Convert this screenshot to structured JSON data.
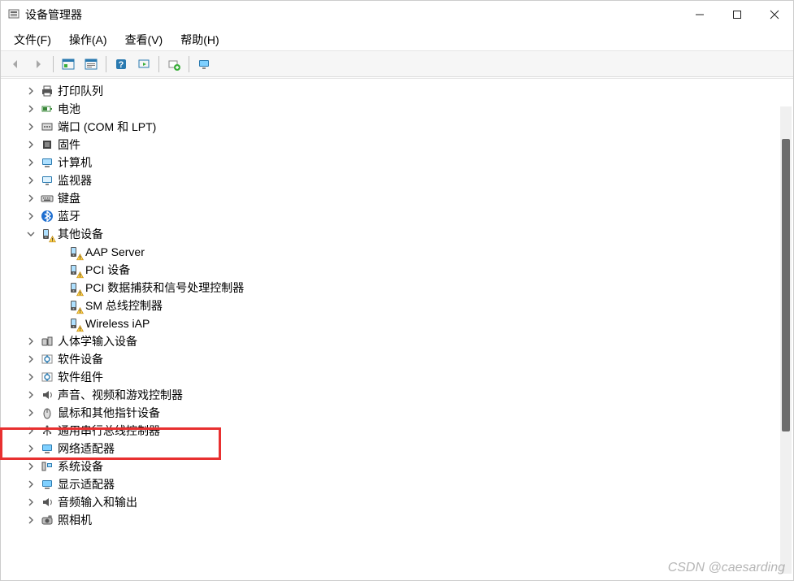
{
  "window": {
    "title": "设备管理器"
  },
  "menu": {
    "file": "文件(F)",
    "action": "操作(A)",
    "view": "查看(V)",
    "help": "帮助(H)"
  },
  "tree": {
    "items": [
      {
        "label": "打印队列",
        "icon": "printer",
        "expand": "collapsed",
        "level": 0
      },
      {
        "label": "电池",
        "icon": "battery",
        "expand": "collapsed",
        "level": 0
      },
      {
        "label": "端口 (COM 和 LPT)",
        "icon": "port",
        "expand": "collapsed",
        "level": 0
      },
      {
        "label": "固件",
        "icon": "firmware",
        "expand": "collapsed",
        "level": 0
      },
      {
        "label": "计算机",
        "icon": "computer",
        "expand": "collapsed",
        "level": 0
      },
      {
        "label": "监视器",
        "icon": "monitor",
        "expand": "collapsed",
        "level": 0
      },
      {
        "label": "键盘",
        "icon": "keyboard",
        "expand": "collapsed",
        "level": 0
      },
      {
        "label": "蓝牙",
        "icon": "bluetooth",
        "expand": "collapsed",
        "level": 0
      },
      {
        "label": "其他设备",
        "icon": "other",
        "expand": "expanded",
        "level": 0,
        "warn": true
      },
      {
        "label": "AAP Server",
        "icon": "other",
        "expand": "none",
        "level": 1,
        "warn": true
      },
      {
        "label": "PCI 设备",
        "icon": "other",
        "expand": "none",
        "level": 1,
        "warn": true
      },
      {
        "label": "PCI 数据捕获和信号处理控制器",
        "icon": "other",
        "expand": "none",
        "level": 1,
        "warn": true
      },
      {
        "label": "SM 总线控制器",
        "icon": "other",
        "expand": "none",
        "level": 1,
        "warn": true
      },
      {
        "label": "Wireless iAP",
        "icon": "other",
        "expand": "none",
        "level": 1,
        "warn": true
      },
      {
        "label": "人体学输入设备",
        "icon": "hid",
        "expand": "collapsed",
        "level": 0
      },
      {
        "label": "软件设备",
        "icon": "software",
        "expand": "collapsed",
        "level": 0
      },
      {
        "label": "软件组件",
        "icon": "software",
        "expand": "collapsed",
        "level": 0
      },
      {
        "label": "声音、视频和游戏控制器",
        "icon": "sound",
        "expand": "collapsed",
        "level": 0
      },
      {
        "label": "鼠标和其他指针设备",
        "icon": "mouse",
        "expand": "collapsed",
        "level": 0
      },
      {
        "label": "通用串行总线控制器",
        "icon": "usb",
        "expand": "collapsed",
        "level": 0
      },
      {
        "label": "网络适配器",
        "icon": "network",
        "expand": "collapsed",
        "level": 0,
        "highlight": true
      },
      {
        "label": "系统设备",
        "icon": "system",
        "expand": "collapsed",
        "level": 0
      },
      {
        "label": "显示适配器",
        "icon": "display",
        "expand": "collapsed",
        "level": 0
      },
      {
        "label": "音频输入和输出",
        "icon": "sound",
        "expand": "collapsed",
        "level": 0
      },
      {
        "label": "照相机",
        "icon": "camera",
        "expand": "collapsed",
        "level": 0
      }
    ]
  },
  "watermark": "CSDN @caesarding"
}
